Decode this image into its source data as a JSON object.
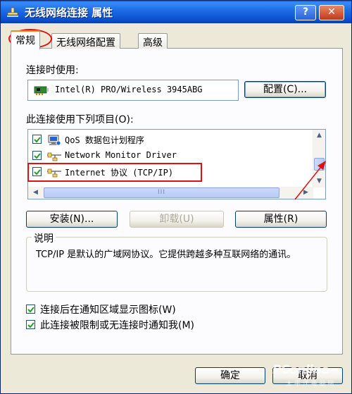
{
  "window": {
    "title": "无线网络连接 属性",
    "help_label": "?",
    "close_label": "✕"
  },
  "tabs": [
    {
      "label": "常规",
      "active": true
    },
    {
      "label": "无线网络配置",
      "active": false
    },
    {
      "label": "高级",
      "active": false
    }
  ],
  "general": {
    "connect_using_label": "连接时使用:",
    "adapter_name": "Intel(R) PRO/Wireless 3945ABG",
    "configure_label": "配置(C)...",
    "items_label": "此连接使用下列项目(O):",
    "items": [
      {
        "label": "QoS 数据包计划程序",
        "checked": true,
        "icon": "qos-scheduler-icon"
      },
      {
        "label": "Network Monitor Driver",
        "checked": true,
        "icon": "network-protocol-icon"
      },
      {
        "label": "Internet 协议 (TCP/IP)",
        "checked": true,
        "icon": "network-protocol-icon"
      }
    ],
    "scroll_up": "▲",
    "scroll_down": "▼",
    "scroll_left": "◀",
    "scroll_right": "▶",
    "hscroll_grip": "III",
    "install_label": "安装(N)...",
    "uninstall_label": "卸载(U)",
    "properties_label": "属性(R)",
    "description_title": "说明",
    "description_text": "TCP/IP 是默认的广域网协议。它提供跨越多种互联网络的通讯。",
    "show_icon_label": "连接后在通知区域显示图标(W)",
    "show_icon_checked": true,
    "notify_label": "此连接被限制或无连接时通知我(M)",
    "notify_checked": true
  },
  "footer": {
    "ok_label": "确定",
    "cancel_label": "取消"
  },
  "watermark": {
    "brand": "PConline",
    "sub": "太 平 洋 电 脑 网"
  },
  "colors": {
    "titlebar": "#0a5fe0",
    "annotation_red": "#e01010",
    "active_tab_accent": "#e68b2c"
  }
}
